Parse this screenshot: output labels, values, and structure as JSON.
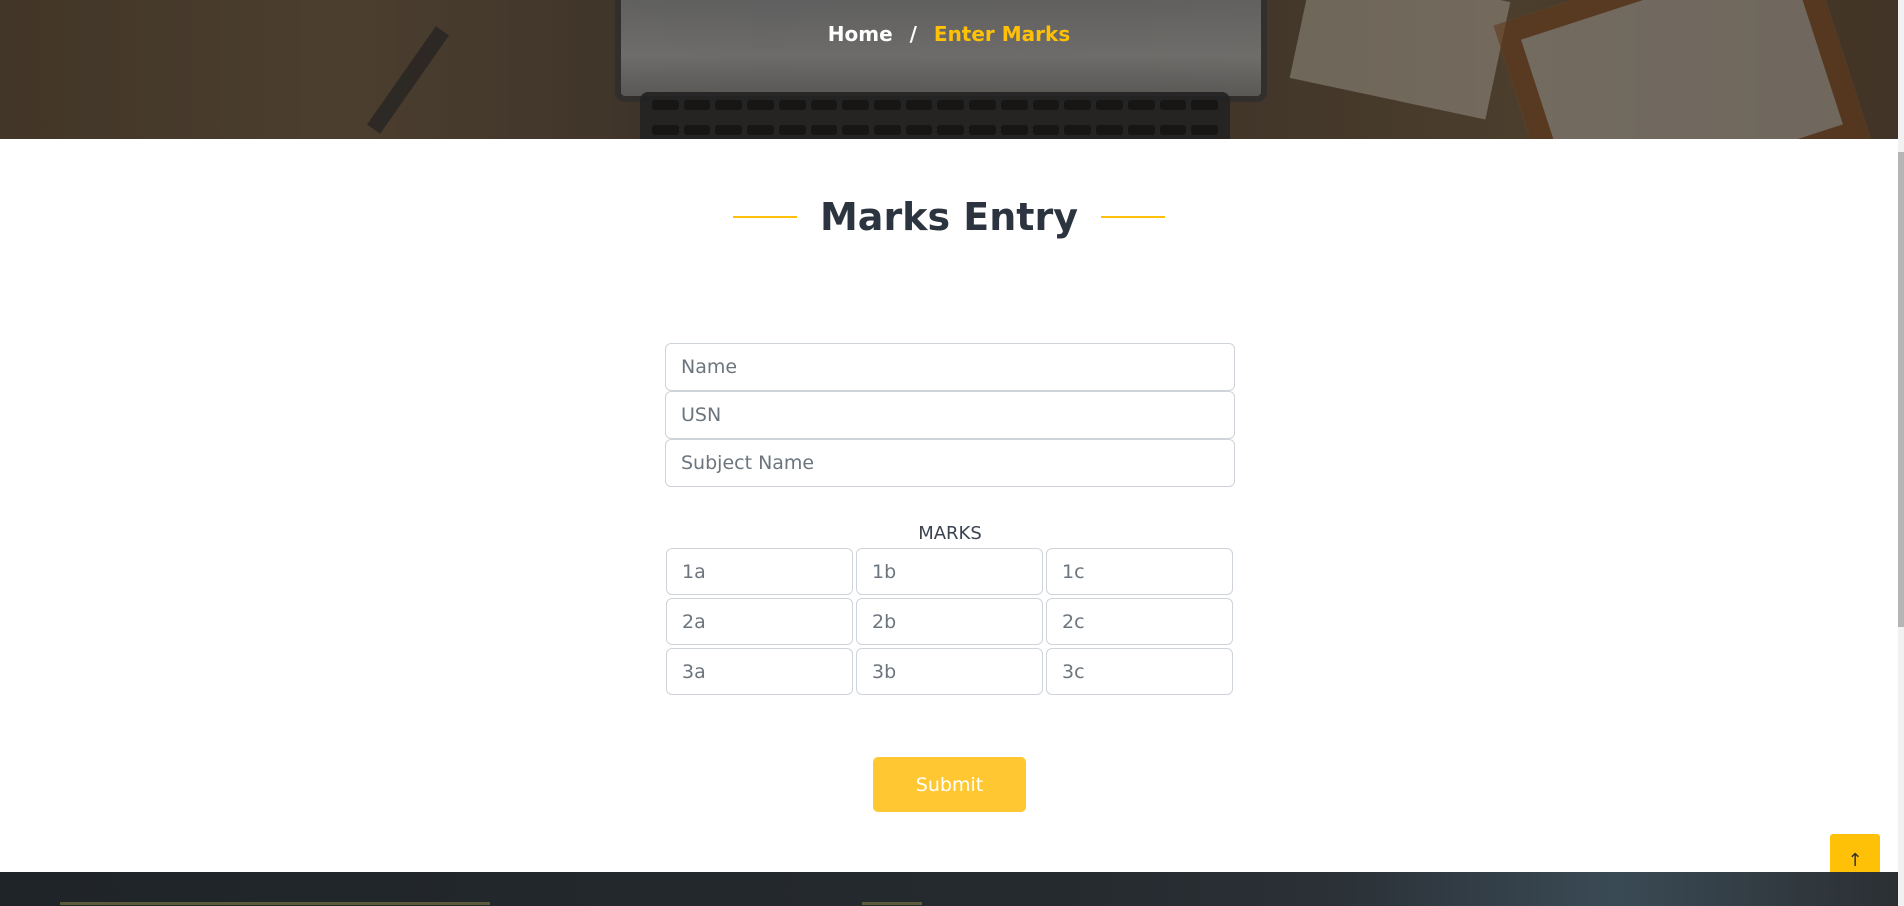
{
  "breadcrumb": {
    "home": "Home",
    "separator": "/",
    "current": "Enter Marks"
  },
  "section": {
    "title": "Marks Entry"
  },
  "form": {
    "name_placeholder": "Name",
    "usn_placeholder": "USN",
    "subject_placeholder": "Subject Name",
    "marks_label": "MARKS",
    "marks": [
      [
        "1a",
        "1b",
        "1c"
      ],
      [
        "2a",
        "2b",
        "2c"
      ],
      [
        "3a",
        "3b",
        "3c"
      ]
    ],
    "submit_label": "Submit"
  },
  "back_to_top": {
    "icon": "arrow-up-icon",
    "glyph": "↑"
  },
  "colors": {
    "accent": "#ffc107",
    "submit": "#ffc832",
    "title": "#2c3440"
  }
}
